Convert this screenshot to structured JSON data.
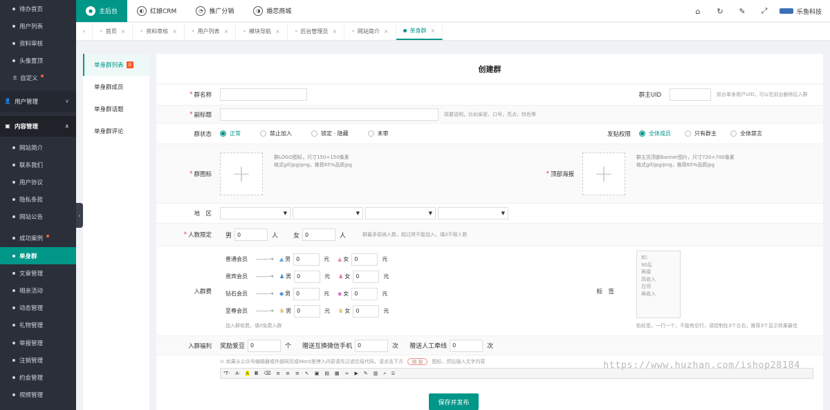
{
  "sidebar": {
    "top_items": [
      {
        "label": "待办首页"
      },
      {
        "label": "用户列表"
      },
      {
        "label": "资料审核"
      },
      {
        "label": "头像置顶"
      },
      {
        "label": "自定义"
      }
    ],
    "group_user": "用户管理",
    "group_content": "内容管理",
    "content_items": [
      {
        "label": "网站简介"
      },
      {
        "label": "联系我们"
      },
      {
        "label": "用户协议"
      },
      {
        "label": "隐私条款"
      },
      {
        "label": "网站公告"
      },
      {
        "label": "成功案例"
      },
      {
        "label": "单身群"
      },
      {
        "label": "文章管理"
      },
      {
        "label": "相亲活动"
      },
      {
        "label": "动态管理"
      },
      {
        "label": "礼物管理"
      },
      {
        "label": "举报管理"
      },
      {
        "label": "注销管理"
      },
      {
        "label": "约会管理"
      },
      {
        "label": "视频管理"
      }
    ]
  },
  "topbar": {
    "nav": [
      "主后台",
      "红娘CRM",
      "推广分销",
      "婚恋商城"
    ],
    "brand": "乐鱼科技"
  },
  "tabs": [
    "首页",
    "资料审核",
    "用户列表",
    "模块导航",
    "后台管理员",
    "网站简介",
    "单身群"
  ],
  "submenu": {
    "items": [
      "单身群列表",
      "单身群成员",
      "单身群话题",
      "单身群评论"
    ],
    "badge": "0"
  },
  "form": {
    "title": "创建群",
    "name_label": "群名称",
    "owner_label": "群主UID",
    "owner_hint": "前台单身用户UID，可以在前台删除后入群",
    "subtitle_label": "副标题",
    "subtitle_hint": "简要说明，比如亲密，口号，亮点，特色等",
    "status_label": "群状态",
    "status_options": [
      "正常",
      "禁止加入",
      "锁定 · 隐藏",
      "未审"
    ],
    "post_label": "发贴权限",
    "post_options": [
      "全体成员",
      "只有群主",
      "全体禁言"
    ],
    "icon_label": "群图标",
    "icon_hint_1": "群LOGO图标，尺寸150×150像素",
    "icon_hint_2": "格式gif/jpg/png，推荐65%品质jpg",
    "banner_label": "顶部海报",
    "banner_hint_1": "群主页顶部Banner图片，尺寸720×700像素",
    "banner_hint_2": "格式gif/jpg/png，推荐65%品质jpg",
    "region_label": "地　区",
    "limit_label": "人数限定",
    "male": "男",
    "female": "女",
    "person_unit": "人",
    "male_limit": "0",
    "female_limit": "0",
    "limit_hint": "群最多容纳人数，超过将不能加入，填0不限人数",
    "fee_label": "入群费",
    "fee_rows": [
      {
        "name": "普通会员",
        "male": "0",
        "female": "0"
      },
      {
        "name": "贵宾会员",
        "male": "0",
        "female": "0"
      },
      {
        "name": "钻石会员",
        "male": "0",
        "female": "0"
      },
      {
        "name": "至尊会员",
        "male": "0",
        "female": "0"
      }
    ],
    "arrow": "——→",
    "yuan": "元",
    "fee_hint": "加入群收费，填0免费入群",
    "tags_label": "标　签",
    "tags_placeholder": [
      "如：",
      "90后",
      "再婚",
      "高收入",
      "白领",
      "再收入"
    ],
    "tags_hint": "贴标签，一行一个，不能有空行，请控制在3个左右，推荐3个显示效果最佳",
    "welfare_label": "入群福利",
    "welfare_items": [
      {
        "label": "奖励爱豆",
        "value": "0",
        "unit": "个"
      },
      {
        "label": "赠送互换微信手机",
        "value": "0",
        "unit": "次"
      },
      {
        "label": "赠送人工牵线",
        "value": "0",
        "unit": "次"
      }
    ],
    "editor_hint": "如果从公众号编辑器或外部网页或Word里拷入内容请先过滤垃圾代码，请点击下方",
    "editor_hint_2": "图标，然后插入文字内容",
    "save_button": "保存并发布"
  },
  "watermark": "https://www.huzhan.com/ishop28184"
}
